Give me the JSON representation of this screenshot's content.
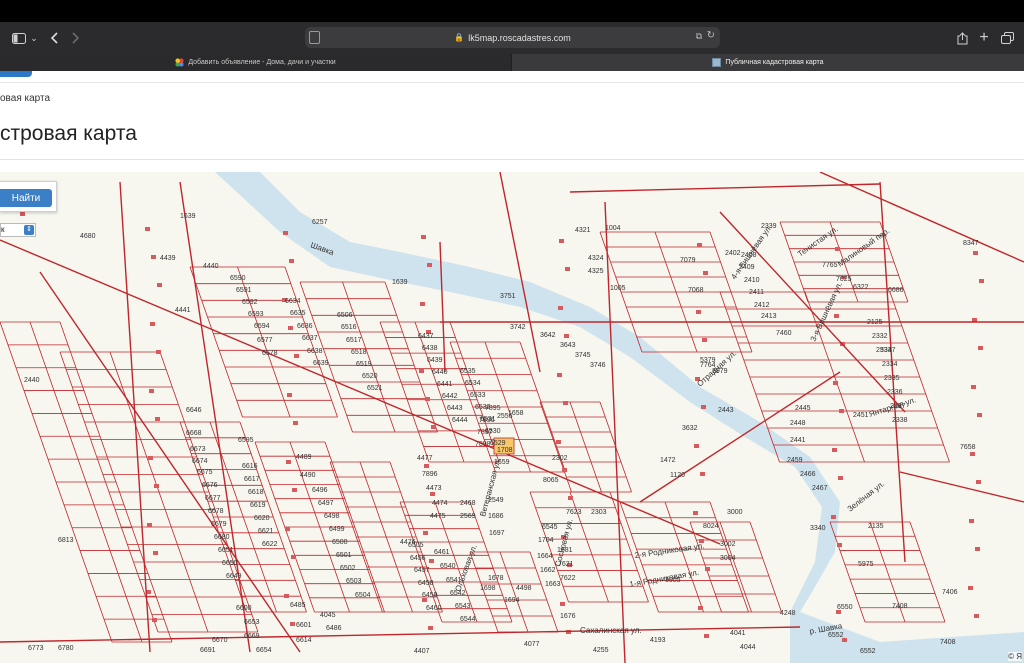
{
  "browser": {
    "url": "lk5map.roscadastres.com",
    "tabs": [
      {
        "label": "Добавить объявление - Дома, дачи и участки"
      },
      {
        "label": "Публичная кадастровая карта"
      }
    ]
  },
  "page": {
    "breadcrumb": "овая карта",
    "title": "стровая карта"
  },
  "map": {
    "search_button": "Найти",
    "select_value": "к",
    "attribution": "© Я",
    "labels": [
      {
        "text": "1639"
      },
      {
        "text": "4680"
      },
      {
        "text": "4439"
      },
      {
        "text": "4440"
      },
      {
        "text": "4441"
      },
      {
        "text": "1639"
      },
      {
        "text": "3751"
      },
      {
        "text": "3742"
      },
      {
        "text": "4321"
      },
      {
        "text": "1004"
      },
      {
        "text": "4324"
      },
      {
        "text": "4325"
      },
      {
        "text": "1005"
      },
      {
        "text": "8347"
      },
      {
        "text": "3632"
      },
      {
        "text": "7658"
      },
      {
        "text": "3340"
      },
      {
        "text": "5975"
      },
      {
        "text": "7406"
      },
      {
        "text": "7408"
      },
      {
        "text": "7408"
      },
      {
        "text": "6550"
      },
      {
        "text": "6552"
      },
      {
        "text": "6552"
      },
      {
        "text": "4248"
      },
      {
        "text": "1708"
      },
      {
        "text": "6813"
      },
      {
        "text": "6646"
      },
      {
        "text": "6668"
      },
      {
        "text": "6673"
      },
      {
        "text": "6674"
      },
      {
        "text": "6675"
      },
      {
        "text": "6676"
      },
      {
        "text": "6677"
      },
      {
        "text": "6678"
      },
      {
        "text": "6679"
      },
      {
        "text": "6680"
      },
      {
        "text": "6651"
      },
      {
        "text": "6650"
      },
      {
        "text": "6649"
      },
      {
        "text": "6595"
      },
      {
        "text": "6616"
      },
      {
        "text": "6617"
      },
      {
        "text": "6618"
      },
      {
        "text": "6619"
      },
      {
        "text": "6620"
      },
      {
        "text": "6621"
      },
      {
        "text": "6622"
      },
      {
        "text": "6590"
      },
      {
        "text": "6591"
      },
      {
        "text": "6592"
      },
      {
        "text": "6593"
      },
      {
        "text": "6594"
      },
      {
        "text": "6577"
      },
      {
        "text": "6578"
      },
      {
        "text": "6634"
      },
      {
        "text": "6635"
      },
      {
        "text": "6636"
      },
      {
        "text": "6637"
      },
      {
        "text": "6638"
      },
      {
        "text": "6639"
      },
      {
        "text": "6506"
      },
      {
        "text": "6516"
      },
      {
        "text": "6517"
      },
      {
        "text": "6518"
      },
      {
        "text": "6519"
      },
      {
        "text": "6520"
      },
      {
        "text": "6521"
      },
      {
        "text": "6437"
      },
      {
        "text": "6438"
      },
      {
        "text": "6439"
      },
      {
        "text": "6440"
      },
      {
        "text": "6441"
      },
      {
        "text": "6442"
      },
      {
        "text": "6443"
      },
      {
        "text": "6444"
      },
      {
        "text": "6535"
      },
      {
        "text": "6534"
      },
      {
        "text": "6533"
      },
      {
        "text": "6532"
      },
      {
        "text": "6531"
      },
      {
        "text": "6530"
      },
      {
        "text": "6529"
      },
      {
        "text": "7895"
      },
      {
        "text": "7896"
      },
      {
        "text": "7897"
      },
      {
        "text": "7898"
      },
      {
        "text": "1658"
      },
      {
        "text": "1659"
      },
      {
        "text": "4489"
      },
      {
        "text": "4490"
      },
      {
        "text": "6496"
      },
      {
        "text": "6497"
      },
      {
        "text": "6498"
      },
      {
        "text": "6499"
      },
      {
        "text": "6500"
      },
      {
        "text": "6501"
      },
      {
        "text": "6502"
      },
      {
        "text": "6503"
      },
      {
        "text": "6504"
      },
      {
        "text": "6505"
      },
      {
        "text": "6456"
      },
      {
        "text": "6457"
      },
      {
        "text": "6458"
      },
      {
        "text": "6459"
      },
      {
        "text": "6460"
      },
      {
        "text": "6461"
      },
      {
        "text": "6540"
      },
      {
        "text": "6541"
      },
      {
        "text": "6542"
      },
      {
        "text": "6543"
      },
      {
        "text": "6544"
      },
      {
        "text": "6545"
      },
      {
        "text": "1704"
      },
      {
        "text": "1664"
      },
      {
        "text": "1662"
      },
      {
        "text": "1663"
      },
      {
        "text": "1681"
      },
      {
        "text": "7621"
      },
      {
        "text": "7622"
      },
      {
        "text": "7623"
      },
      {
        "text": "2303"
      },
      {
        "text": "2302"
      },
      {
        "text": "8065"
      },
      {
        "text": "8024"
      },
      {
        "text": "3000"
      },
      {
        "text": "3002"
      },
      {
        "text": "3004"
      },
      {
        "text": "3005"
      },
      {
        "text": "6322"
      },
      {
        "text": "2125"
      },
      {
        "text": "2332"
      },
      {
        "text": "2333"
      },
      {
        "text": "2334"
      },
      {
        "text": "2335"
      },
      {
        "text": "2336"
      },
      {
        "text": "2337"
      },
      {
        "text": "2338"
      },
      {
        "text": "2339"
      },
      {
        "text": "2402"
      },
      {
        "text": "2408"
      },
      {
        "text": "2409"
      },
      {
        "text": "2410"
      },
      {
        "text": "2411"
      },
      {
        "text": "2412"
      },
      {
        "text": "2413"
      },
      {
        "text": "7460"
      },
      {
        "text": "7025"
      },
      {
        "text": "7765"
      },
      {
        "text": "7764"
      },
      {
        "text": "2443"
      },
      {
        "text": "2445"
      },
      {
        "text": "2448"
      },
      {
        "text": "2451"
      },
      {
        "text": "2459"
      },
      {
        "text": "2466"
      },
      {
        "text": "2467"
      },
      {
        "text": "2468"
      },
      {
        "text": "2569"
      },
      {
        "text": "2549"
      },
      {
        "text": "1686"
      },
      {
        "text": "1697"
      },
      {
        "text": "1698"
      },
      {
        "text": "1694"
      },
      {
        "text": "1678"
      },
      {
        "text": "1676"
      },
      {
        "text": "2556"
      },
      {
        "text": "7896"
      },
      {
        "text": "4477"
      },
      {
        "text": "4473"
      },
      {
        "text": "4474"
      },
      {
        "text": "4475"
      },
      {
        "text": "4476"
      },
      {
        "text": "4498"
      },
      {
        "text": "4407"
      },
      {
        "text": "4077"
      },
      {
        "text": "4255"
      },
      {
        "text": "4193"
      },
      {
        "text": "4041"
      },
      {
        "text": "4044"
      },
      {
        "text": "4045"
      },
      {
        "text": "6486"
      },
      {
        "text": "6485"
      },
      {
        "text": "6601"
      },
      {
        "text": "6614"
      },
      {
        "text": "6600"
      },
      {
        "text": "6653"
      },
      {
        "text": "6669"
      },
      {
        "text": "6654"
      },
      {
        "text": "6670"
      },
      {
        "text": "6691"
      },
      {
        "text": "6773"
      },
      {
        "text": "6780"
      },
      {
        "text": "7079"
      },
      {
        "text": "7068"
      },
      {
        "text": "5379"
      },
      {
        "text": "3979"
      },
      {
        "text": "2440"
      },
      {
        "text": "2441"
      },
      {
        "text": "6686"
      },
      {
        "text": "5347"
      },
      {
        "text": "2135"
      },
      {
        "text": "6257"
      },
      {
        "text": "1472"
      },
      {
        "text": "1120"
      },
      {
        "text": "3642"
      },
      {
        "text": "3643"
      },
      {
        "text": "3745"
      },
      {
        "text": "3746"
      },
      {
        "text": "3747"
      },
      {
        "text": "3748"
      }
    ],
    "streets": [
      {
        "text": "Янтарная ул."
      },
      {
        "text": "2-я Родниковая ул."
      },
      {
        "text": "1-я Родниковая ул."
      },
      {
        "text": "Сахалинская ул."
      },
      {
        "text": "Отрадная ул."
      },
      {
        "text": "4-я Вишнёвая ул."
      },
      {
        "text": "3-я Вишнёвая ул."
      },
      {
        "text": "Тенистая ул."
      },
      {
        "text": "Зелёная ул."
      },
      {
        "text": "Малиновый пер."
      },
      {
        "text": "Ветеранская ул."
      },
      {
        "text": "Сосновая ул."
      },
      {
        "text": "Шавка"
      },
      {
        "text": "р. Шавка"
      },
      {
        "text": "Ольховая ул."
      }
    ]
  },
  "colors": {
    "parcel_border": "#c0262b",
    "river": "#cfe3ee",
    "map_bg": "#f7f6ef",
    "highlight": "#f6c86a",
    "button": "#3b7fc6"
  },
  "icons": [
    "sidebar-icon",
    "back-icon",
    "forward-icon",
    "page-icon",
    "lock-icon",
    "translate-icon",
    "reload-icon",
    "share-icon",
    "new-tab-icon",
    "tabs-overview-icon"
  ]
}
